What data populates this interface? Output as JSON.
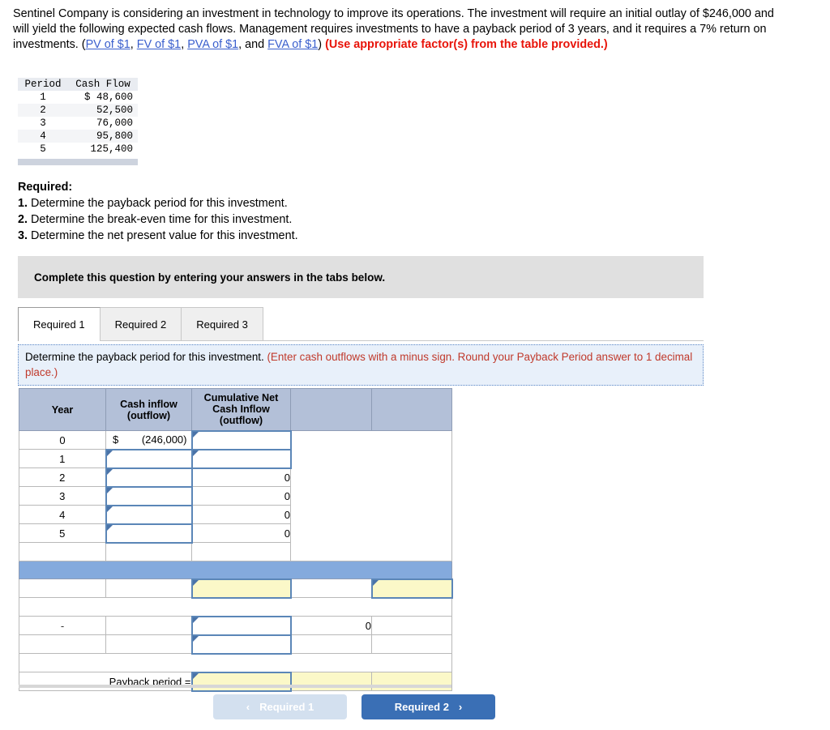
{
  "problem": {
    "line1": "Sentinel Company is considering an investment in technology to improve its operations. The investment will require an initial outlay of $246,000 and will yield the following expected cash flows. Management requires investments to have a payback period of 3 years, and it requires a 7% return on investments. (",
    "links": [
      {
        "label": "PV of $1"
      },
      {
        "label": "FV of $1"
      },
      {
        "label": "PVA of $1"
      },
      {
        "label": "FVA of $1"
      }
    ],
    "sep1": ", ",
    "sep2": ", ",
    "sep3": ", and ",
    "closing": ") ",
    "note": "(Use appropriate factor(s) from the table provided.)"
  },
  "cash_flow_table": {
    "headers": [
      "Period",
      "Cash Flow"
    ],
    "rows": [
      {
        "period": "1",
        "amount": "$  48,600"
      },
      {
        "period": "2",
        "amount": "52,500"
      },
      {
        "period": "3",
        "amount": "76,000"
      },
      {
        "period": "4",
        "amount": "95,800"
      },
      {
        "period": "5",
        "amount": "125,400"
      }
    ]
  },
  "required": {
    "heading": "Required:",
    "items": [
      {
        "num": "1.",
        "text": " Determine the payback period for this investment."
      },
      {
        "num": "2.",
        "text": " Determine the break-even time for this investment."
      },
      {
        "num": "3.",
        "text": " Determine the net present value for this investment."
      }
    ]
  },
  "banner": {
    "text": "Complete this question by entering your answers in the tabs below."
  },
  "tabs": [
    {
      "label": "Required 1",
      "active": true
    },
    {
      "label": "Required 2",
      "active": false
    },
    {
      "label": "Required 3",
      "active": false
    }
  ],
  "instruction": {
    "main": "Determine the payback period for this investment. ",
    "hint": "(Enter cash outflows with a minus sign. Round your Payback Period answer to 1 decimal place.)"
  },
  "answer_grid": {
    "headers": [
      "Year",
      "Cash inflow\n(outflow)",
      "Cumulative Net\nCash Inflow\n(outflow)",
      "",
      ""
    ],
    "header_year": "Year",
    "header_cash_l1": "Cash inflow",
    "header_cash_l2": "(outflow)",
    "header_cum_l1": "Cumulative Net",
    "header_cum_l2": "Cash Inflow",
    "header_cum_l3": "(outflow)",
    "rows": [
      {
        "year": "0",
        "cash_symbol": "$",
        "cash_value": "(246,000)",
        "cash_input": false,
        "cum_input": true,
        "cum_value": ""
      },
      {
        "year": "1",
        "cash_symbol": "",
        "cash_value": "",
        "cash_input": true,
        "cum_input": true,
        "cum_value": ""
      },
      {
        "year": "2",
        "cash_symbol": "",
        "cash_value": "",
        "cash_input": true,
        "cum_input": false,
        "cum_value": "0"
      },
      {
        "year": "3",
        "cash_symbol": "",
        "cash_value": "",
        "cash_input": true,
        "cum_input": false,
        "cum_value": "0"
      },
      {
        "year": "4",
        "cash_symbol": "",
        "cash_value": "",
        "cash_input": true,
        "cum_input": false,
        "cum_value": "0"
      },
      {
        "year": "5",
        "cash_symbol": "",
        "cash_value": "",
        "cash_input": true,
        "cum_input": false,
        "cum_value": "0"
      }
    ],
    "dash_row_label": "-",
    "dash_row_value": "0",
    "payback_label": "Payback period ="
  },
  "nav": {
    "prev_chevron": "‹",
    "prev_label": "Required 1",
    "next_label": "Required 2",
    "next_chevron": "›"
  },
  "colors": {
    "accent_blue": "#3a6fb5",
    "header_blue": "#b3c0d8",
    "bar_blue": "#84aadd",
    "input_yellow": "#fbf8c8",
    "link_blue": "#3a5fcd",
    "red": "#e8140a"
  }
}
